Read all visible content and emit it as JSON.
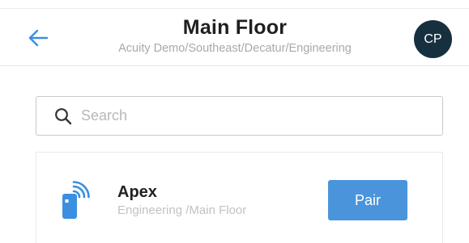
{
  "header": {
    "title": "Main Floor",
    "breadcrumb": "Acuity Demo/Southeast/Decatur/Engineering",
    "avatar_initials": "CP"
  },
  "search": {
    "placeholder": "Search",
    "value": ""
  },
  "devices": [
    {
      "name": "Apex",
      "location": "Engineering /Main Floor",
      "action_label": "Pair",
      "icon": "wireless-sensor-icon"
    }
  ],
  "colors": {
    "accent": "#4a94dc",
    "back_arrow": "#3a8fe0",
    "avatar_bg": "#173040",
    "title": "#1f1f1f",
    "muted_text": "#a9a9a9"
  },
  "icons": {
    "back": "arrow-left-icon",
    "search": "search-icon",
    "device": "wireless-sensor-icon"
  }
}
